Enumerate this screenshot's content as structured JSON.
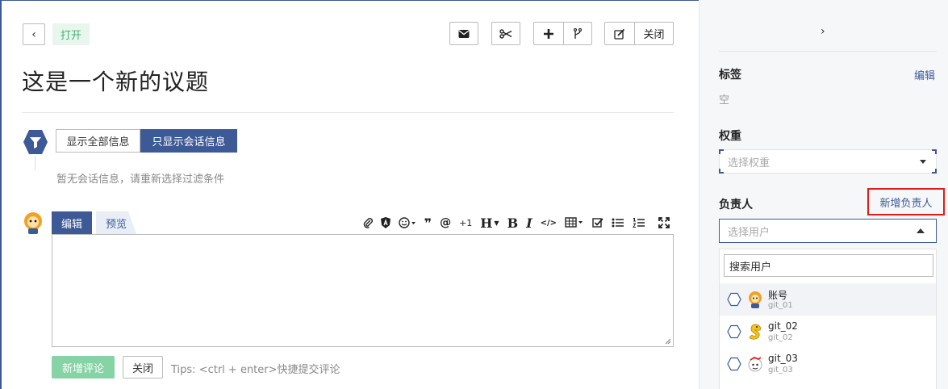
{
  "issue": {
    "status": "打开",
    "title": "这是一个新的议题",
    "close_label": "关闭"
  },
  "filter": {
    "show_all": "显示全部信息",
    "show_conversation": "只显示会话信息",
    "empty_message": "暂无会话信息，请重新选择过滤条件"
  },
  "editor": {
    "tab_edit": "编辑",
    "tab_preview": "预览",
    "plus_one": "+1",
    "submit": "新增评论",
    "close": "关闭",
    "tips": "Tips: <ctrl + enter>快捷提交评论"
  },
  "sidebar": {
    "labels_title": "标签",
    "labels_edit": "编辑",
    "labels_empty": "空",
    "weight_title": "权重",
    "weight_placeholder": "选择权重",
    "assignee_title": "负责人",
    "add_assignee": "新增负责人",
    "user_placeholder": "选择用户",
    "search_placeholder": "搜索用户",
    "users": [
      {
        "name": "账号",
        "login": "git_01"
      },
      {
        "name": "git_02",
        "login": "git_02"
      },
      {
        "name": "git_03",
        "login": "git_03"
      }
    ]
  },
  "colors": {
    "primary": "#3d5a96",
    "success": "#3cb371",
    "highlight": "#e01b1b"
  }
}
